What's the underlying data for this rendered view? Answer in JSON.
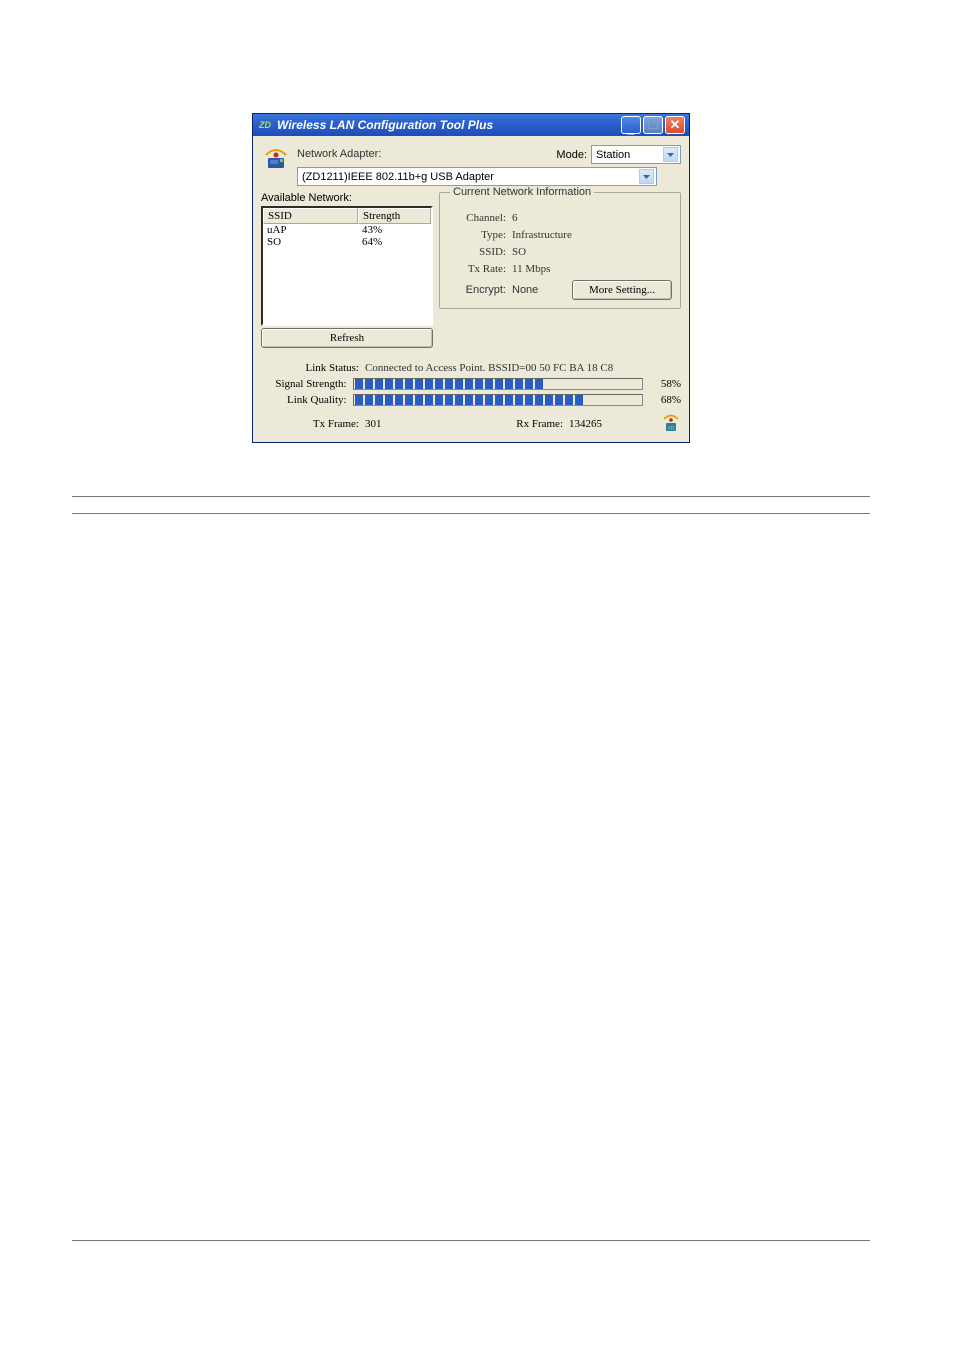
{
  "window": {
    "title": "Wireless LAN Configuration Tool Plus"
  },
  "adapter": {
    "label": "Network Adapter:",
    "selected": "(ZD1211)IEEE 802.11b+g USB Adapter"
  },
  "mode": {
    "label": "Mode:",
    "selected": "Station"
  },
  "available": {
    "label": "Available Network:",
    "col_ssid": "SSID",
    "col_strength": "Strength",
    "rows": [
      {
        "ssid": "uAP",
        "strength": "43%"
      },
      {
        "ssid": "SO",
        "strength": "64%"
      }
    ]
  },
  "buttons": {
    "refresh": "Refresh",
    "more": "More Setting..."
  },
  "info": {
    "legend": "Current Network Information",
    "channel_lbl": "Channel:",
    "channel_val": "6",
    "type_lbl": "Type:",
    "type_val": "Infrastructure",
    "ssid_lbl": "SSID:",
    "ssid_val": "SO",
    "txrate_lbl": "Tx Rate:",
    "txrate_val": "11 Mbps",
    "encrypt_lbl": "Encrypt:",
    "encrypt_val": "None"
  },
  "status": {
    "link_lbl": "Link Status:",
    "link_val": "Connected to Access Point. BSSID=00 50 FC BA 18 C8",
    "sig_lbl": "Signal Strength:",
    "sig_pct": "58%",
    "sig_segs": 19,
    "lq_lbl": "Link Quality:",
    "lq_pct": "68%",
    "lq_segs": 23,
    "tx_lbl": "Tx Frame:",
    "tx_val": "301",
    "rx_lbl": "Rx Frame:",
    "rx_val": "134265"
  }
}
